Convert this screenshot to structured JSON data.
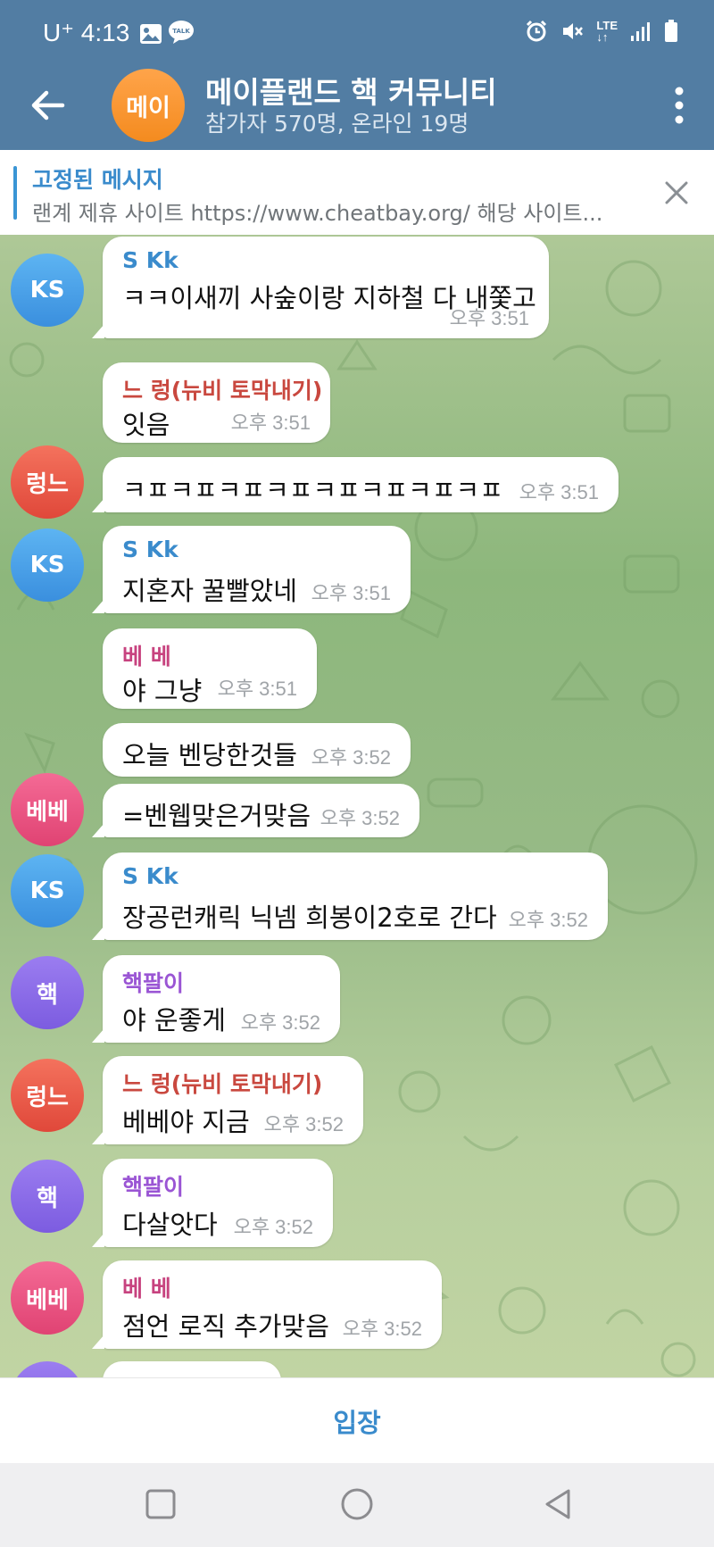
{
  "status_bar": {
    "carrier": "U⁺",
    "time": "4:13",
    "network": "LTE"
  },
  "header": {
    "avatar_text": "메이",
    "title": "메이플랜드 핵 커뮤니티",
    "subtitle": "참가자 570명, 온라인 19명"
  },
  "pinned": {
    "title": "고정된 메시지",
    "text": "랜계 제휴 사이트 https://www.cheatbay.org/  해당 사이트..."
  },
  "messages": [
    {
      "sender": "S Kk",
      "text": "ㅋㅋ이새끼 사숲이랑 지하철 다 내쫓고",
      "time": "오후 3:51"
    },
    {
      "sender": "느 렁(뉴비 토막내기)",
      "text": "잇음",
      "time": "오후 3:51"
    },
    {
      "text": "ㅋㅍㅋㅍㅋㅍㅋㅍㅋㅍㅋㅍㅋㅍㅋㅍ",
      "time": "오후 3:51"
    },
    {
      "sender": "S Kk",
      "text": "지혼자 꿀빨았네",
      "time": "오후 3:51"
    },
    {
      "sender": "베 베",
      "text": "야 그냥",
      "time": "오후 3:51"
    },
    {
      "text": "오늘 벤당한것들",
      "time": "오후 3:52"
    },
    {
      "text": "=벤웹맞은거맞음",
      "time": "오후 3:52"
    },
    {
      "sender": "S Kk",
      "text": "장공런캐릭 닉넴 희봉이2호로 간다",
      "time": "오후 3:52"
    },
    {
      "sender": "핵팔이",
      "text": "야 운좋게",
      "time": "오후 3:52"
    },
    {
      "sender": "느 렁(뉴비 토막내기)",
      "text": "베베야 지금",
      "time": "오후 3:52"
    },
    {
      "sender": "핵팔이",
      "text": "다살앗다",
      "time": "오후 3:52"
    },
    {
      "sender": "베 베",
      "text": "점언 로직 추가맞음",
      "time": "오후 3:52"
    }
  ],
  "avatars": [
    "KS",
    "렁느",
    "KS",
    "베베",
    "KS",
    "핵",
    "렁느",
    "핵",
    "베베"
  ],
  "bottom": {
    "join_label": "입장"
  },
  "colors": {
    "header": "#527da3",
    "accent": "#3a8bcc",
    "sender_blue": "#3a8bcc",
    "sender_red": "#c9483f",
    "sender_pink": "#c7437f",
    "sender_purple": "#9a55d4"
  }
}
